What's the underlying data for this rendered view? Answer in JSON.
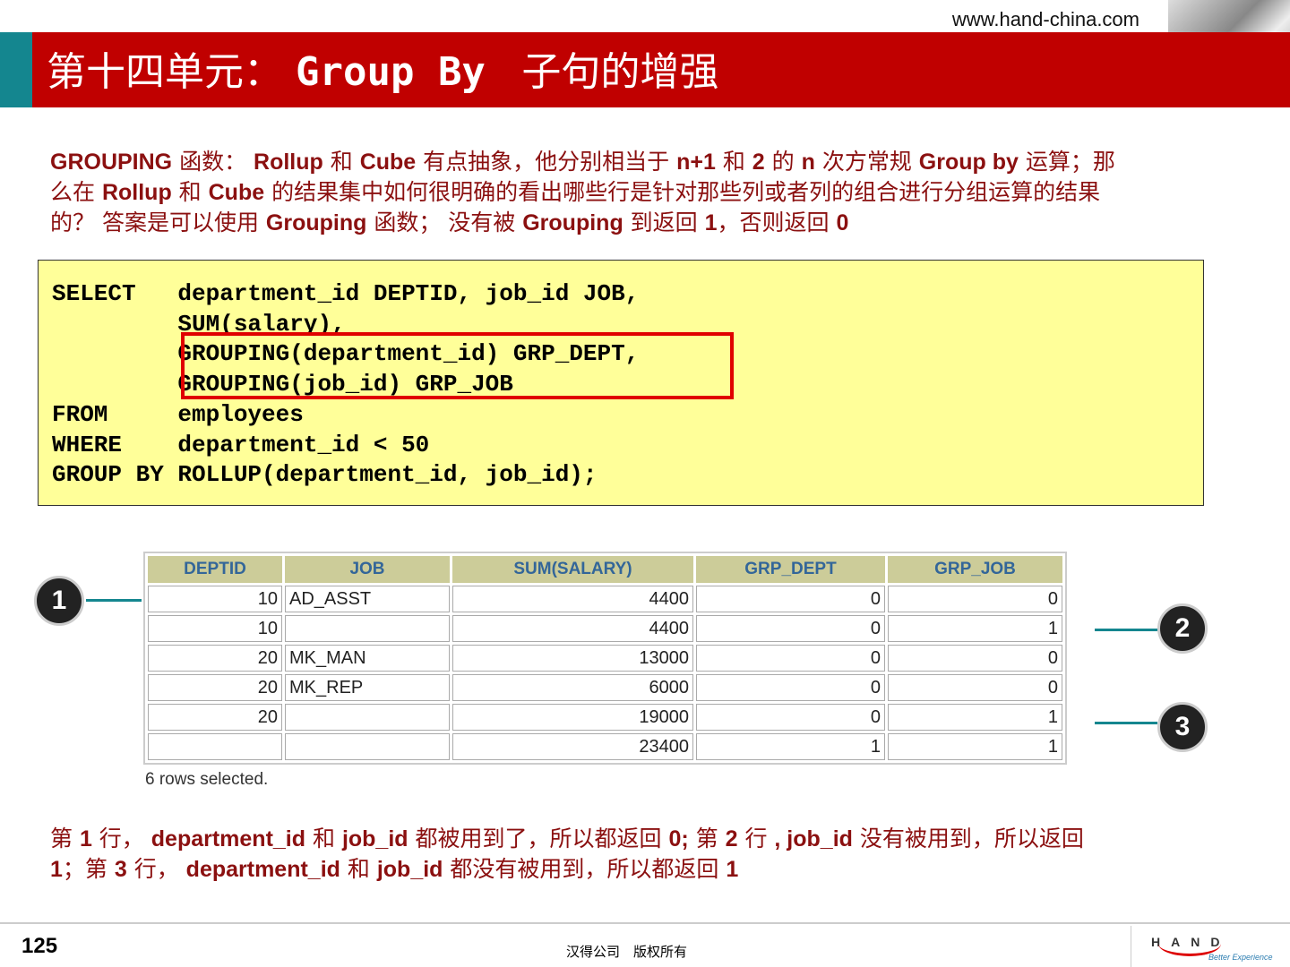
{
  "header": {
    "url": "www.hand-china.com",
    "title_cn": "第十四单元： ",
    "title_en": "Group By ",
    "title_cn2": " 子句的增强"
  },
  "intro": [
    [
      "GROUPING",
      1
    ],
    [
      " 函数： ",
      0
    ],
    [
      "Rollup",
      1
    ],
    [
      " 和 ",
      0
    ],
    [
      "Cube",
      1
    ],
    [
      " 有点抽象，他分别相当于 ",
      0
    ],
    [
      "n+1",
      1
    ],
    [
      " 和 ",
      0
    ],
    [
      "2",
      1
    ],
    [
      " 的 ",
      0
    ],
    [
      "n",
      1
    ],
    [
      " 次方常规 ",
      0
    ],
    [
      "Group by",
      1
    ],
    [
      " 运算；那么在 ",
      0
    ],
    [
      "Rollup",
      1
    ],
    [
      " 和 ",
      0
    ],
    [
      "Cube",
      1
    ],
    [
      " 的结果集中如何很明确的看出哪些行是针对那些列或者列的组合进行分组运算的结果的？ 答案是可以使用 ",
      0
    ],
    [
      "Grouping",
      1
    ],
    [
      " 函数； 没有被 ",
      0
    ],
    [
      "Grouping",
      1
    ],
    [
      " 到返回 ",
      0
    ],
    [
      "1",
      1
    ],
    [
      "，否则返回 ",
      0
    ],
    [
      "0",
      1
    ]
  ],
  "code": [
    "SELECT   department_id DEPTID, job_id JOB,",
    "         SUM(salary),",
    "         GROUPING(department_id) GRP_DEPT,",
    "         GROUPING(job_id) GRP_JOB",
    "FROM     employees",
    "WHERE    department_id < 50",
    "GROUP BY ROLLUP(department_id, job_id);"
  ],
  "table": {
    "headers": [
      "DEPTID",
      "JOB",
      "SUM(SALARY)",
      "GRP_DEPT",
      "GRP_JOB"
    ],
    "rows": [
      [
        "10",
        "AD_ASST",
        "4400",
        "0",
        "0"
      ],
      [
        "10",
        "",
        "4400",
        "0",
        "1"
      ],
      [
        "20",
        "MK_MAN",
        "13000",
        "0",
        "0"
      ],
      [
        "20",
        "MK_REP",
        "6000",
        "0",
        "0"
      ],
      [
        "20",
        "",
        "19000",
        "0",
        "1"
      ],
      [
        "",
        "",
        "23400",
        "1",
        "1"
      ]
    ],
    "footer": "6 rows selected."
  },
  "markers": [
    "1",
    "2",
    "3"
  ],
  "explain": [
    [
      "第 ",
      0
    ],
    [
      "1",
      1
    ],
    [
      " 行， ",
      0
    ],
    [
      "department_id",
      1
    ],
    [
      " 和 ",
      0
    ],
    [
      "job_id",
      1
    ],
    [
      " 都被用到了，所以都返回 ",
      0
    ],
    [
      "0;",
      1
    ],
    [
      " 第 ",
      0
    ],
    [
      "2",
      1
    ],
    [
      " 行 ",
      0
    ],
    [
      ", job_id",
      1
    ],
    [
      " 没有被用到，所以返回 ",
      0
    ],
    [
      "1",
      1
    ],
    [
      "；第 ",
      0
    ],
    [
      "3",
      1
    ],
    [
      " 行， ",
      0
    ],
    [
      "department_id",
      1
    ],
    [
      " 和 ",
      0
    ],
    [
      "job_id",
      1
    ],
    [
      " 都没有被用到，所以都返回 ",
      0
    ],
    [
      "1",
      1
    ]
  ],
  "footer": {
    "page": "125",
    "copyright": "汉得公司　版权所有",
    "logo_text": "HAND",
    "logo_tagline": "Better Experience"
  }
}
